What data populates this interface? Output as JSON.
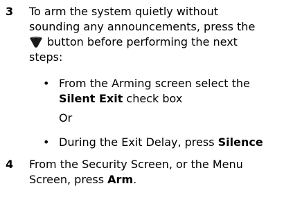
{
  "steps": [
    {
      "number": "3",
      "line1": "To arm the system quietly without",
      "line2": "sounding any announcements, press the",
      "line3_after_icon": "button before performing the next",
      "line4": "steps:"
    },
    {
      "number": "4",
      "line1": "From the Security Screen, or the Menu",
      "line2_pre": "Screen, press ",
      "line2_bold": "Arm",
      "line2_post": "."
    }
  ],
  "bullets": [
    {
      "symbol": "•",
      "line1": "From the Arming screen select the",
      "line2_bold": "Silent Exit",
      "line2_rest": " check box"
    },
    {
      "symbol": "•",
      "pre": "During the Exit Delay, press ",
      "bold": "Silence"
    }
  ],
  "or_text": "Or",
  "icons": {
    "silence": "speaker-mute-icon"
  },
  "colors": {
    "text": "#000000",
    "icon": "#1a1a1a"
  }
}
